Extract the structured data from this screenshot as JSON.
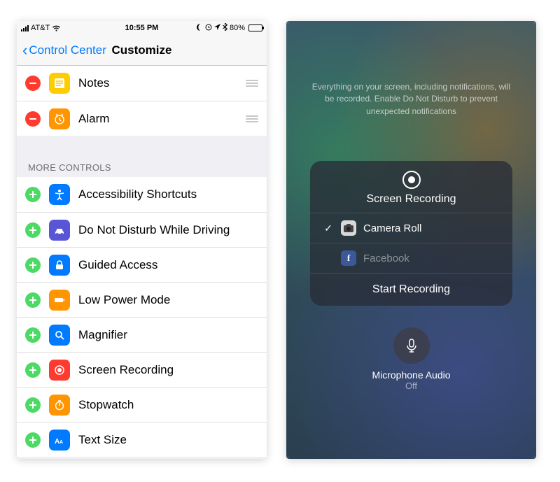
{
  "statusbar": {
    "carrier": "AT&T",
    "time": "10:55 PM",
    "battery_pct": "80%"
  },
  "nav": {
    "back": "Control Center",
    "title": "Customize"
  },
  "included": [
    {
      "label": "Notes",
      "icon": "notes",
      "bg": "bg-yellow"
    },
    {
      "label": "Alarm",
      "icon": "alarm",
      "bg": "bg-orange"
    }
  ],
  "more_header": "MORE CONTROLS",
  "more": [
    {
      "label": "Accessibility Shortcuts",
      "icon": "accessibility",
      "bg": "bg-blue"
    },
    {
      "label": "Do Not Disturb While Driving",
      "icon": "car",
      "bg": "bg-bluesq"
    },
    {
      "label": "Guided Access",
      "icon": "lock",
      "bg": "bg-blue"
    },
    {
      "label": "Low Power Mode",
      "icon": "battery",
      "bg": "bg-orange"
    },
    {
      "label": "Magnifier",
      "icon": "magnifier",
      "bg": "bg-blue"
    },
    {
      "label": "Screen Recording",
      "icon": "record",
      "bg": "bg-red"
    },
    {
      "label": "Stopwatch",
      "icon": "stopwatch",
      "bg": "bg-orange"
    },
    {
      "label": "Text Size",
      "icon": "textsize",
      "bg": "bg-blue"
    }
  ],
  "sheet": {
    "hint": "Everything on your screen, including notifications, will be recorded. Enable Do Not Disturb to prevent unexpected notifications",
    "title": "Screen Recording",
    "options": [
      {
        "label": "Camera Roll",
        "selected": true,
        "kind": "cam"
      },
      {
        "label": "Facebook",
        "selected": false,
        "kind": "fb"
      }
    ],
    "start": "Start Recording",
    "mic_label": "Microphone Audio",
    "mic_state": "Off"
  }
}
